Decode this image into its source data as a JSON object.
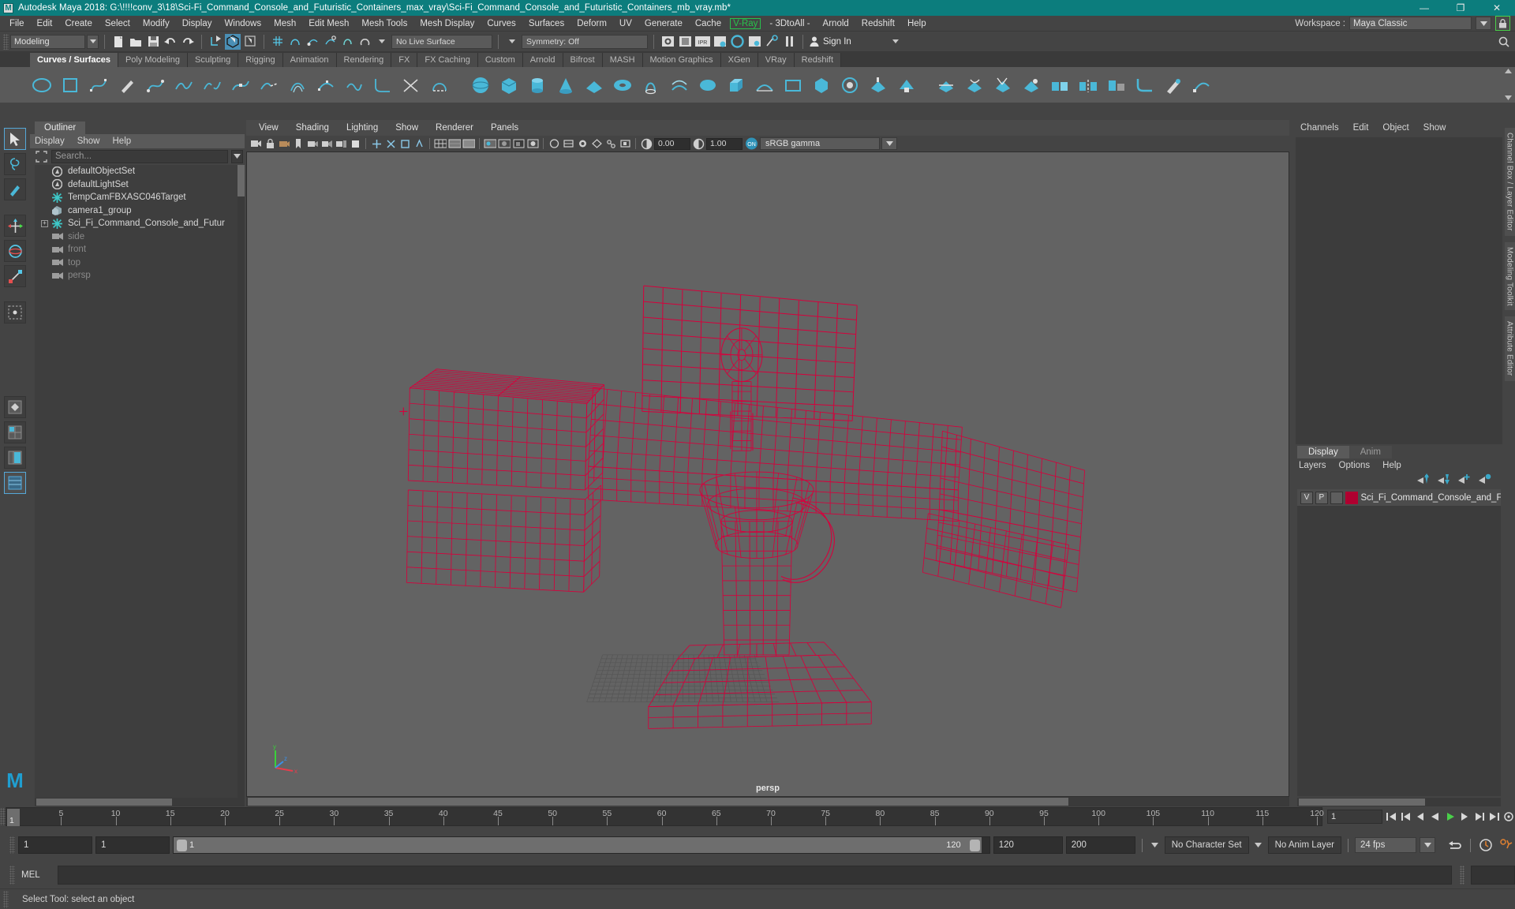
{
  "window": {
    "title": "Autodesk Maya 2018: G:\\!!!!conv_3\\18\\Sci-Fi_Command_Console_and_Futuristic_Containers_max_vray\\Sci-Fi_Command_Console_and_Futuristic_Containers_mb_vray.mb*",
    "app_icon_letter": "M",
    "minimize": "—",
    "maximize": "❐",
    "close": "✕"
  },
  "menubar": {
    "items": [
      "File",
      "Edit",
      "Create",
      "Select",
      "Modify",
      "Display",
      "Windows",
      "Mesh",
      "Edit Mesh",
      "Mesh Tools",
      "Mesh Display",
      "Curves",
      "Surfaces",
      "Deform",
      "UV",
      "Generate",
      "Cache"
    ],
    "vray_item": "V-Ray",
    "items_after": [
      "- 3DtoAll -",
      "Arnold",
      "Redshift",
      "Help"
    ],
    "workspace_label": "Workspace :",
    "workspace_value": "Maya Classic",
    "lock_icon": "lock-icon"
  },
  "statusline": {
    "mode": "Modeling",
    "live_surface": "No Live Surface",
    "symmetry": "Symmetry: Off",
    "signin": "Sign In"
  },
  "shelf": {
    "tabs": [
      "Curves / Surfaces",
      "Poly Modeling",
      "Sculpting",
      "Rigging",
      "Animation",
      "Rendering",
      "FX",
      "FX Caching",
      "Custom",
      "Arnold",
      "Bifrost",
      "MASH",
      "Motion Graphics",
      "XGen",
      "VRay",
      "Redshift"
    ],
    "active_tab": "Curves / Surfaces"
  },
  "outliner": {
    "tab": "Outliner",
    "menus": [
      "Display",
      "Show",
      "Help"
    ],
    "search_placeholder": "Search...",
    "items": [
      {
        "label": "persp",
        "icon": "camera-icon",
        "dim": true,
        "expandable": false
      },
      {
        "label": "top",
        "icon": "camera-icon",
        "dim": true,
        "expandable": false
      },
      {
        "label": "front",
        "icon": "camera-icon",
        "dim": true,
        "expandable": false
      },
      {
        "label": "side",
        "icon": "camera-icon",
        "dim": true,
        "expandable": false
      },
      {
        "label": "Sci_Fi_Command_Console_and_Futur",
        "icon": "transform-icon",
        "dim": false,
        "expandable": true
      },
      {
        "label": "camera1_group",
        "icon": "group-icon",
        "dim": false,
        "expandable": false
      },
      {
        "label": "TempCamFBXASC046Target",
        "icon": "transform-icon",
        "dim": false,
        "expandable": false
      },
      {
        "label": "defaultLightSet",
        "icon": "set-icon",
        "dim": false,
        "expandable": false
      },
      {
        "label": "defaultObjectSet",
        "icon": "set-icon",
        "dim": false,
        "expandable": false
      }
    ]
  },
  "viewport": {
    "menus": [
      "View",
      "Shading",
      "Lighting",
      "Show",
      "Renderer",
      "Panels"
    ],
    "exposure_value": "0.00",
    "gamma_value": "1.00",
    "color_management": "sRGB gamma",
    "camera_label": "persp",
    "wireframe_color": "#d6003c",
    "background_color": "#636363",
    "axis_labels": {
      "y": "y",
      "x": "x",
      "z": "z"
    }
  },
  "channelbox": {
    "menus": [
      "Channels",
      "Edit",
      "Object",
      "Show"
    ],
    "vertical_tabs": [
      "Channel Box / Layer Editor",
      "Modeling Toolkit",
      "Attribute Editor"
    ]
  },
  "layereditor": {
    "tabs": [
      "Display",
      "Anim"
    ],
    "active_tab": "Display",
    "menus": [
      "Layers",
      "Options",
      "Help"
    ],
    "column_v": "V",
    "column_p": "P",
    "layers": [
      {
        "v": "V",
        "p": "P",
        "color": "#b00030",
        "name": "Sci_Fi_Command_Console_and_F"
      }
    ]
  },
  "timeslider": {
    "current_frame": "1",
    "ticks": [
      5,
      10,
      15,
      20,
      25,
      30,
      35,
      40,
      45,
      50,
      55,
      60,
      65,
      70,
      75,
      80,
      85,
      90,
      95,
      100,
      105,
      110,
      115,
      120
    ],
    "end_field": "1",
    "playback_icons": [
      "go-to-start-icon",
      "step-back-key-icon",
      "step-back-icon",
      "play-back-icon",
      "play-forward-icon",
      "step-forward-icon",
      "step-forward-key-icon",
      "go-to-end-icon"
    ]
  },
  "rangeslider": {
    "anim_start": "1",
    "range_start": "1",
    "slider_start_value": "1",
    "slider_end_value": "120",
    "range_end": "120",
    "anim_end": "200",
    "character_set": "No Character Set",
    "anim_layer": "No Anim Layer",
    "fps": "24 fps"
  },
  "commandline": {
    "label": "MEL",
    "value": "",
    "placeholder": ""
  },
  "helpline": {
    "text": "Select Tool: select an object"
  }
}
